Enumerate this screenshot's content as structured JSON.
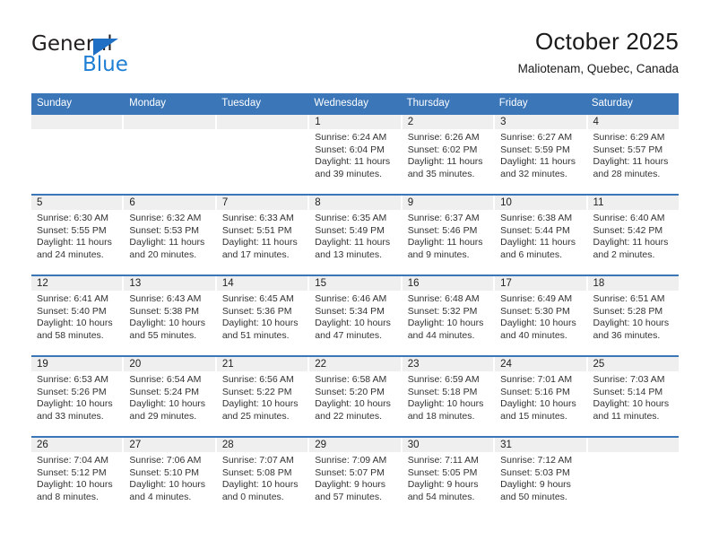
{
  "logo": {
    "word_one": "General",
    "word_two": "Blue",
    "triangle_icon": "blue-triangle-icon",
    "accent_color": "#1f7fd4"
  },
  "header": {
    "title": "October 2025",
    "subtitle": "Maliotenam, Quebec, Canada"
  },
  "theme": {
    "header_blue": "#3a76b8",
    "date_band": "#efefef",
    "text": "#333333"
  },
  "weekdays": [
    "Sunday",
    "Monday",
    "Tuesday",
    "Wednesday",
    "Thursday",
    "Friday",
    "Saturday"
  ],
  "labels": {
    "sunrise": "Sunrise:",
    "sunset": "Sunset:",
    "daylight": "Daylight:"
  },
  "weeks": [
    {
      "days": [
        {
          "date": "",
          "sunrise": "",
          "sunset": "",
          "daylight": ""
        },
        {
          "date": "",
          "sunrise": "",
          "sunset": "",
          "daylight": ""
        },
        {
          "date": "",
          "sunrise": "",
          "sunset": "",
          "daylight": ""
        },
        {
          "date": "1",
          "sunrise": "Sunrise: 6:24 AM",
          "sunset": "Sunset: 6:04 PM",
          "daylight": "Daylight: 11 hours and 39 minutes."
        },
        {
          "date": "2",
          "sunrise": "Sunrise: 6:26 AM",
          "sunset": "Sunset: 6:02 PM",
          "daylight": "Daylight: 11 hours and 35 minutes."
        },
        {
          "date": "3",
          "sunrise": "Sunrise: 6:27 AM",
          "sunset": "Sunset: 5:59 PM",
          "daylight": "Daylight: 11 hours and 32 minutes."
        },
        {
          "date": "4",
          "sunrise": "Sunrise: 6:29 AM",
          "sunset": "Sunset: 5:57 PM",
          "daylight": "Daylight: 11 hours and 28 minutes."
        }
      ]
    },
    {
      "days": [
        {
          "date": "5",
          "sunrise": "Sunrise: 6:30 AM",
          "sunset": "Sunset: 5:55 PM",
          "daylight": "Daylight: 11 hours and 24 minutes."
        },
        {
          "date": "6",
          "sunrise": "Sunrise: 6:32 AM",
          "sunset": "Sunset: 5:53 PM",
          "daylight": "Daylight: 11 hours and 20 minutes."
        },
        {
          "date": "7",
          "sunrise": "Sunrise: 6:33 AM",
          "sunset": "Sunset: 5:51 PM",
          "daylight": "Daylight: 11 hours and 17 minutes."
        },
        {
          "date": "8",
          "sunrise": "Sunrise: 6:35 AM",
          "sunset": "Sunset: 5:49 PM",
          "daylight": "Daylight: 11 hours and 13 minutes."
        },
        {
          "date": "9",
          "sunrise": "Sunrise: 6:37 AM",
          "sunset": "Sunset: 5:46 PM",
          "daylight": "Daylight: 11 hours and 9 minutes."
        },
        {
          "date": "10",
          "sunrise": "Sunrise: 6:38 AM",
          "sunset": "Sunset: 5:44 PM",
          "daylight": "Daylight: 11 hours and 6 minutes."
        },
        {
          "date": "11",
          "sunrise": "Sunrise: 6:40 AM",
          "sunset": "Sunset: 5:42 PM",
          "daylight": "Daylight: 11 hours and 2 minutes."
        }
      ]
    },
    {
      "days": [
        {
          "date": "12",
          "sunrise": "Sunrise: 6:41 AM",
          "sunset": "Sunset: 5:40 PM",
          "daylight": "Daylight: 10 hours and 58 minutes."
        },
        {
          "date": "13",
          "sunrise": "Sunrise: 6:43 AM",
          "sunset": "Sunset: 5:38 PM",
          "daylight": "Daylight: 10 hours and 55 minutes."
        },
        {
          "date": "14",
          "sunrise": "Sunrise: 6:45 AM",
          "sunset": "Sunset: 5:36 PM",
          "daylight": "Daylight: 10 hours and 51 minutes."
        },
        {
          "date": "15",
          "sunrise": "Sunrise: 6:46 AM",
          "sunset": "Sunset: 5:34 PM",
          "daylight": "Daylight: 10 hours and 47 minutes."
        },
        {
          "date": "16",
          "sunrise": "Sunrise: 6:48 AM",
          "sunset": "Sunset: 5:32 PM",
          "daylight": "Daylight: 10 hours and 44 minutes."
        },
        {
          "date": "17",
          "sunrise": "Sunrise: 6:49 AM",
          "sunset": "Sunset: 5:30 PM",
          "daylight": "Daylight: 10 hours and 40 minutes."
        },
        {
          "date": "18",
          "sunrise": "Sunrise: 6:51 AM",
          "sunset": "Sunset: 5:28 PM",
          "daylight": "Daylight: 10 hours and 36 minutes."
        }
      ]
    },
    {
      "days": [
        {
          "date": "19",
          "sunrise": "Sunrise: 6:53 AM",
          "sunset": "Sunset: 5:26 PM",
          "daylight": "Daylight: 10 hours and 33 minutes."
        },
        {
          "date": "20",
          "sunrise": "Sunrise: 6:54 AM",
          "sunset": "Sunset: 5:24 PM",
          "daylight": "Daylight: 10 hours and 29 minutes."
        },
        {
          "date": "21",
          "sunrise": "Sunrise: 6:56 AM",
          "sunset": "Sunset: 5:22 PM",
          "daylight": "Daylight: 10 hours and 25 minutes."
        },
        {
          "date": "22",
          "sunrise": "Sunrise: 6:58 AM",
          "sunset": "Sunset: 5:20 PM",
          "daylight": "Daylight: 10 hours and 22 minutes."
        },
        {
          "date": "23",
          "sunrise": "Sunrise: 6:59 AM",
          "sunset": "Sunset: 5:18 PM",
          "daylight": "Daylight: 10 hours and 18 minutes."
        },
        {
          "date": "24",
          "sunrise": "Sunrise: 7:01 AM",
          "sunset": "Sunset: 5:16 PM",
          "daylight": "Daylight: 10 hours and 15 minutes."
        },
        {
          "date": "25",
          "sunrise": "Sunrise: 7:03 AM",
          "sunset": "Sunset: 5:14 PM",
          "daylight": "Daylight: 10 hours and 11 minutes."
        }
      ]
    },
    {
      "days": [
        {
          "date": "26",
          "sunrise": "Sunrise: 7:04 AM",
          "sunset": "Sunset: 5:12 PM",
          "daylight": "Daylight: 10 hours and 8 minutes."
        },
        {
          "date": "27",
          "sunrise": "Sunrise: 7:06 AM",
          "sunset": "Sunset: 5:10 PM",
          "daylight": "Daylight: 10 hours and 4 minutes."
        },
        {
          "date": "28",
          "sunrise": "Sunrise: 7:07 AM",
          "sunset": "Sunset: 5:08 PM",
          "daylight": "Daylight: 10 hours and 0 minutes."
        },
        {
          "date": "29",
          "sunrise": "Sunrise: 7:09 AM",
          "sunset": "Sunset: 5:07 PM",
          "daylight": "Daylight: 9 hours and 57 minutes."
        },
        {
          "date": "30",
          "sunrise": "Sunrise: 7:11 AM",
          "sunset": "Sunset: 5:05 PM",
          "daylight": "Daylight: 9 hours and 54 minutes."
        },
        {
          "date": "31",
          "sunrise": "Sunrise: 7:12 AM",
          "sunset": "Sunset: 5:03 PM",
          "daylight": "Daylight: 9 hours and 50 minutes."
        },
        {
          "date": "",
          "sunrise": "",
          "sunset": "",
          "daylight": ""
        }
      ]
    }
  ]
}
